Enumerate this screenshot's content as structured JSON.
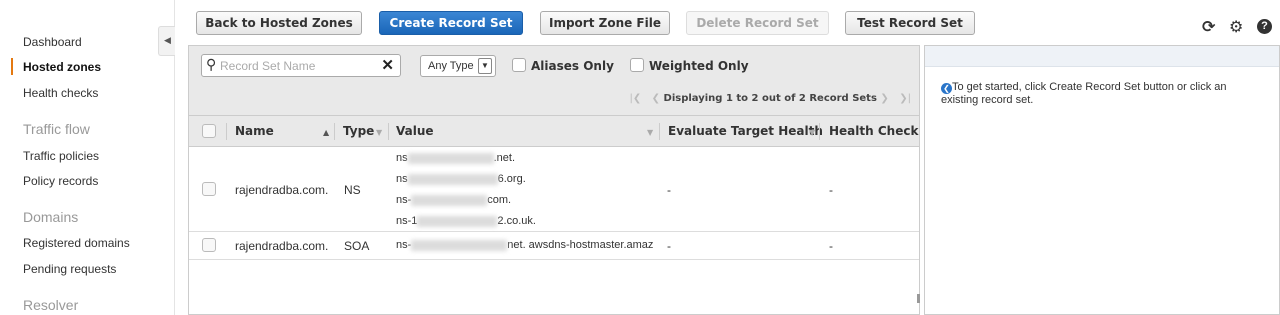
{
  "sidebar": {
    "items": [
      {
        "label": "Dashboard"
      },
      {
        "label": "Hosted zones",
        "active": true
      },
      {
        "label": "Health checks"
      }
    ],
    "sections": [
      {
        "title": "Traffic flow",
        "items": [
          {
            "label": "Traffic policies"
          },
          {
            "label": "Policy records"
          }
        ]
      },
      {
        "title": "Domains",
        "items": [
          {
            "label": "Registered domains"
          },
          {
            "label": "Pending requests"
          }
        ]
      },
      {
        "title": "Resolver"
      }
    ]
  },
  "toolbar": {
    "back_label": "Back to Hosted Zones",
    "create_label": "Create Record Set",
    "import_label": "Import Zone File",
    "delete_label": "Delete Record Set",
    "test_label": "Test Record Set"
  },
  "icons": {
    "refresh": "refresh-icon",
    "settings": "gear-icon",
    "help": "help-icon"
  },
  "filters": {
    "search_placeholder": "Record Set Name",
    "type_value": "Any Type",
    "aliases_label": "Aliases Only",
    "weighted_label": "Weighted Only",
    "pager_text": "Displaying 1 to 2 out of 2 Record Sets"
  },
  "table": {
    "columns": [
      "Name",
      "Type",
      "Value",
      "Evaluate Target Health",
      "Health Check I"
    ],
    "rows": [
      {
        "name": "rajendradba.com.",
        "type": "NS",
        "values": [
          {
            "prefix": "ns",
            "suffix": ".net."
          },
          {
            "prefix": "ns",
            "suffix": "6.org."
          },
          {
            "prefix": "ns-",
            "suffix": "com."
          },
          {
            "prefix": "ns-1",
            "suffix": "2.co.uk."
          }
        ],
        "evaluate": "-",
        "health": "-"
      },
      {
        "name": "rajendradba.com.",
        "type": "SOA",
        "values": [
          {
            "prefix": "ns-",
            "suffix": "net. awsdns-hostmaster.amaz"
          }
        ],
        "evaluate": "-",
        "health": "-"
      }
    ]
  },
  "info": {
    "message": "To get started, click Create Record Set button or click an existing record set."
  },
  "colors": {
    "accent": "#e47911",
    "primary": "#1a66b8",
    "info_dot": "#2a75c9"
  }
}
